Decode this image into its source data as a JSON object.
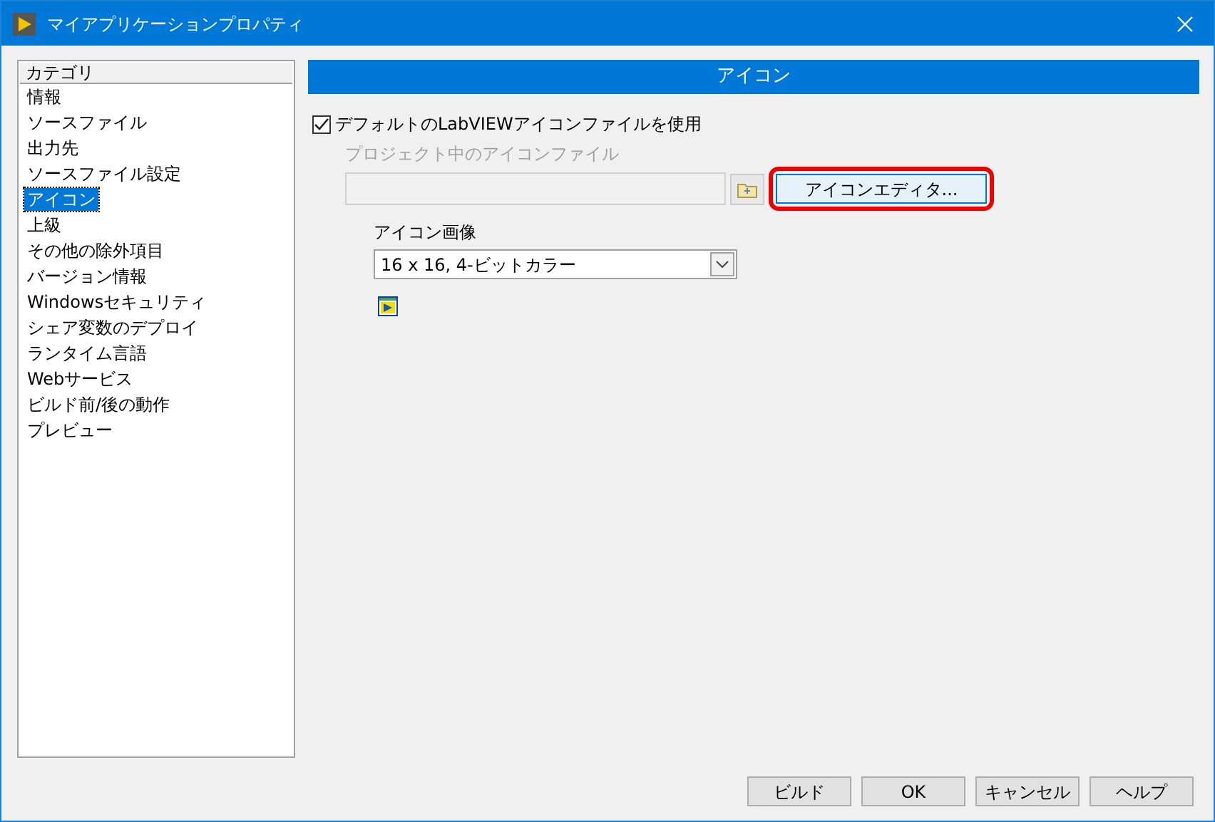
{
  "window": {
    "title": "マイアプリケーションプロパティ"
  },
  "categories": {
    "header": "カテゴリ",
    "items": [
      {
        "label": "情報",
        "selected": false
      },
      {
        "label": "ソースファイル",
        "selected": false
      },
      {
        "label": "出力先",
        "selected": false
      },
      {
        "label": "ソースファイル設定",
        "selected": false
      },
      {
        "label": "アイコン",
        "selected": true
      },
      {
        "label": "上級",
        "selected": false
      },
      {
        "label": "その他の除外項目",
        "selected": false
      },
      {
        "label": "バージョン情報",
        "selected": false
      },
      {
        "label": "Windowsセキュリティ",
        "selected": false
      },
      {
        "label": "シェア変数のデプロイ",
        "selected": false
      },
      {
        "label": "ランタイム言語",
        "selected": false
      },
      {
        "label": "Webサービス",
        "selected": false
      },
      {
        "label": "ビルド前/後の動作",
        "selected": false
      },
      {
        "label": "プレビュー",
        "selected": false
      }
    ]
  },
  "panel": {
    "title": "アイコン",
    "use_default": {
      "label": "デフォルトのLabVIEWアイコンファイルを使用",
      "checked": true
    },
    "project_icon_file": {
      "label": "プロジェクト中のアイコンファイル",
      "disabled": true
    },
    "icon_editor_button": {
      "label": "アイコンエディタ...",
      "highlighted": true
    },
    "icon_image": {
      "label": "アイコン画像",
      "value": "16 x 16, 4-ビットカラー"
    }
  },
  "buttons": [
    "ビルド",
    "OK",
    "キャンセル",
    "ヘルプ"
  ]
}
